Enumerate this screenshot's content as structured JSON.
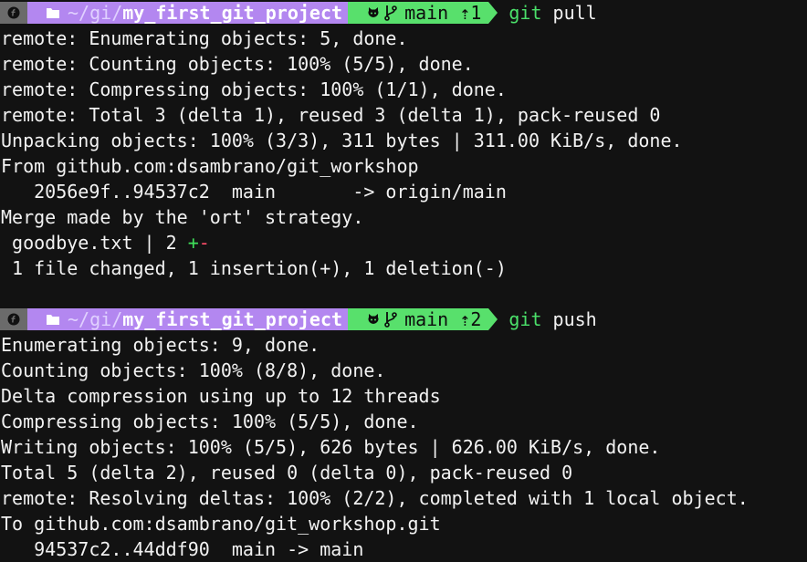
{
  "colors": {
    "background": "#121212",
    "os_segment": "#6b6b6b",
    "path_segment": "#b387f0",
    "git_segment": "#58e06c",
    "command": "#4be06a",
    "insert": "#3fe05a",
    "delete": "#ff4d6a"
  },
  "prompt1": {
    "path_home": "~/",
    "path_mid": "gi",
    "path_sep": "/",
    "path_dir": "my_first_git_project",
    "branch": "main",
    "ahead": "⇡1",
    "command": "git",
    "command_arg": "pull"
  },
  "pull_output": [
    "remote: Enumerating objects: 5, done.",
    "remote: Counting objects: 100% (5/5), done.",
    "remote: Compressing objects: 100% (1/1), done.",
    "remote: Total 3 (delta 1), reused 3 (delta 1), pack-reused 0",
    "Unpacking objects: 100% (3/3), 311 bytes | 311.00 KiB/s, done.",
    "From github.com:dsambrano/git_workshop",
    "   2056e9f..94537c2  main       -> origin/main",
    "Merge made by the 'ort' strategy."
  ],
  "diffstat": {
    "file_line": " goodbye.txt | 2 ",
    "plus": "+",
    "minus": "-",
    "summary": " 1 file changed, 1 insertion(+), 1 deletion(-)"
  },
  "prompt2": {
    "path_home": "~/",
    "path_mid": "gi",
    "path_sep": "/",
    "path_dir": "my_first_git_project",
    "branch": "main",
    "ahead": "⇡2",
    "command": "git",
    "command_arg": "push"
  },
  "push_output": [
    "Enumerating objects: 9, done.",
    "Counting objects: 100% (8/8), done.",
    "Delta compression using up to 12 threads",
    "Compressing objects: 100% (5/5), done.",
    "Writing objects: 100% (5/5), 626 bytes | 626.00 KiB/s, done.",
    "Total 5 (delta 2), reused 0 (delta 0), pack-reused 0",
    "remote: Resolving deltas: 100% (2/2), completed with 1 local object.",
    "To github.com:dsambrano/git_workshop.git",
    "   94537c2..44ddf90  main -> main"
  ]
}
